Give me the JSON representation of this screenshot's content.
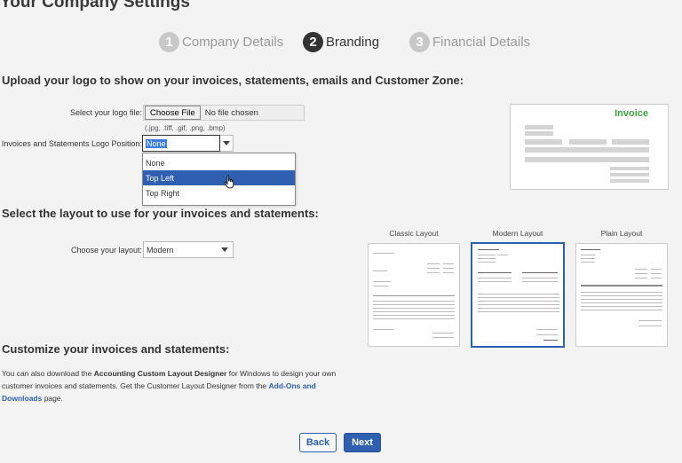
{
  "page_title": "Your Company Settings",
  "steps": [
    {
      "number": "1",
      "label": "Company Details",
      "active": false
    },
    {
      "number": "2",
      "label": "Branding",
      "active": true
    },
    {
      "number": "3",
      "label": "Financial Details",
      "active": false
    }
  ],
  "logo_section": {
    "heading": "Upload your logo to show on your invoices, statements, emails and Customer Zone:",
    "file_label": "Select your logo file:",
    "file_button": "Choose File",
    "file_status": "No file chosen",
    "file_hint": "(.jpg, .tiff, .gif, .png, .bmp)",
    "position_label": "Invoices and Statements Logo Position:",
    "position_value": "None",
    "position_options": [
      "None",
      "Top Left",
      "Top Right"
    ],
    "highlighted_option": "Top Left"
  },
  "invoice_preview": {
    "title": "Invoice",
    "title_color": "#3aa040"
  },
  "layout_section": {
    "heading": "Select the layout to use for your invoices and statements:",
    "choose_label": "Choose your layout:",
    "choose_value": "Modern",
    "layouts": [
      {
        "name": "Classic Layout",
        "selected": false
      },
      {
        "name": "Modern Layout",
        "selected": true
      },
      {
        "name": "Plain Layout",
        "selected": false
      }
    ]
  },
  "customize_section": {
    "heading": "Customize your invoices and statements:",
    "text_1": "You can also download the ",
    "designer_name": "Accounting Custom Layout Designer",
    "text_2": " for Windows to design your own customer invoices and statements. Get the Customer Layout Designer from the ",
    "link_text": "Add-Ons and Downloads",
    "text_3": " page."
  },
  "buttons": {
    "back": "Back",
    "next": "Next"
  },
  "colors": {
    "accent": "#2e5fb0",
    "highlight": "#3b7de0"
  }
}
